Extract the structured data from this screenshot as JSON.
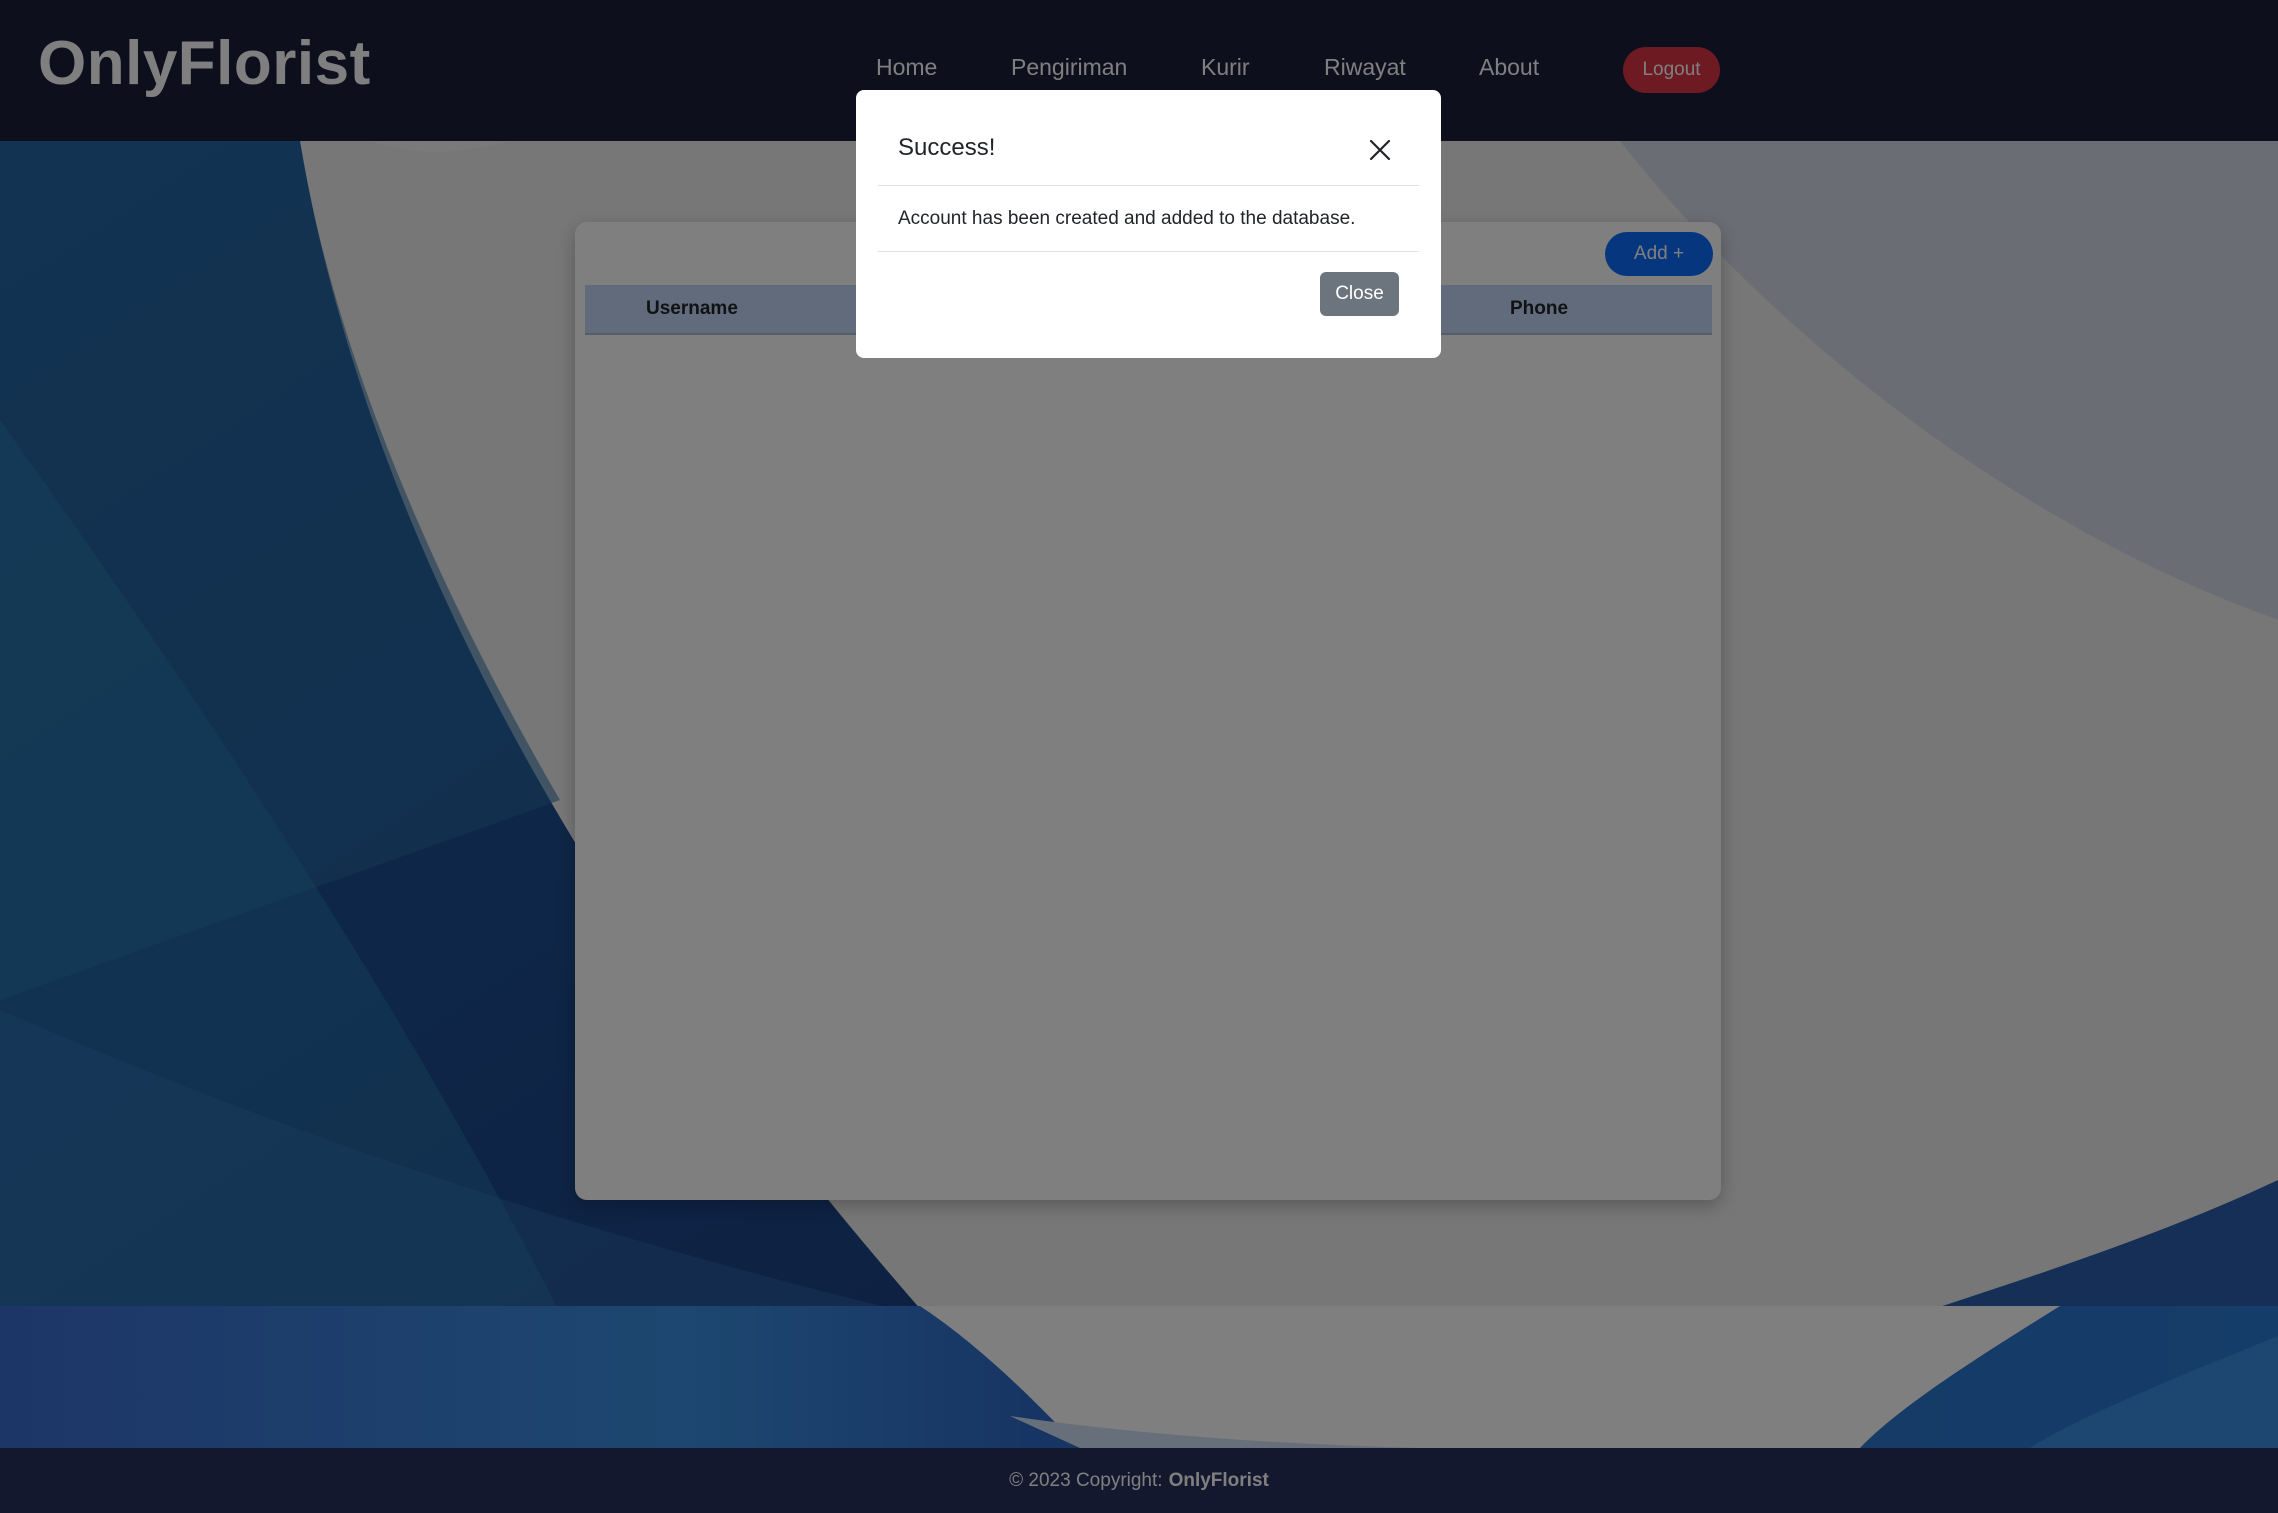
{
  "brand": "OnlyFlorist",
  "nav": {
    "items": [
      {
        "label": "Home"
      },
      {
        "label": "Pengiriman"
      },
      {
        "label": "Kurir"
      },
      {
        "label": "Riwayat"
      },
      {
        "label": "About"
      }
    ],
    "logout_label": "Logout"
  },
  "table": {
    "add_label": "Add +",
    "columns": [
      "Username",
      "Phone"
    ],
    "rows": []
  },
  "modal": {
    "title": "Success!",
    "message": "Account has been created and added to the database.",
    "close_label": "Close"
  },
  "footer": {
    "copyright": "© 2023 Copyright:",
    "brand": "OnlyFlorist"
  },
  "colors": {
    "navbar": "#1b1f3b",
    "logout": "#dc3545",
    "primary": "#0d6efd",
    "secondary": "#6c757d",
    "table_header": "#c5d7f7",
    "footer": "#28305e"
  }
}
